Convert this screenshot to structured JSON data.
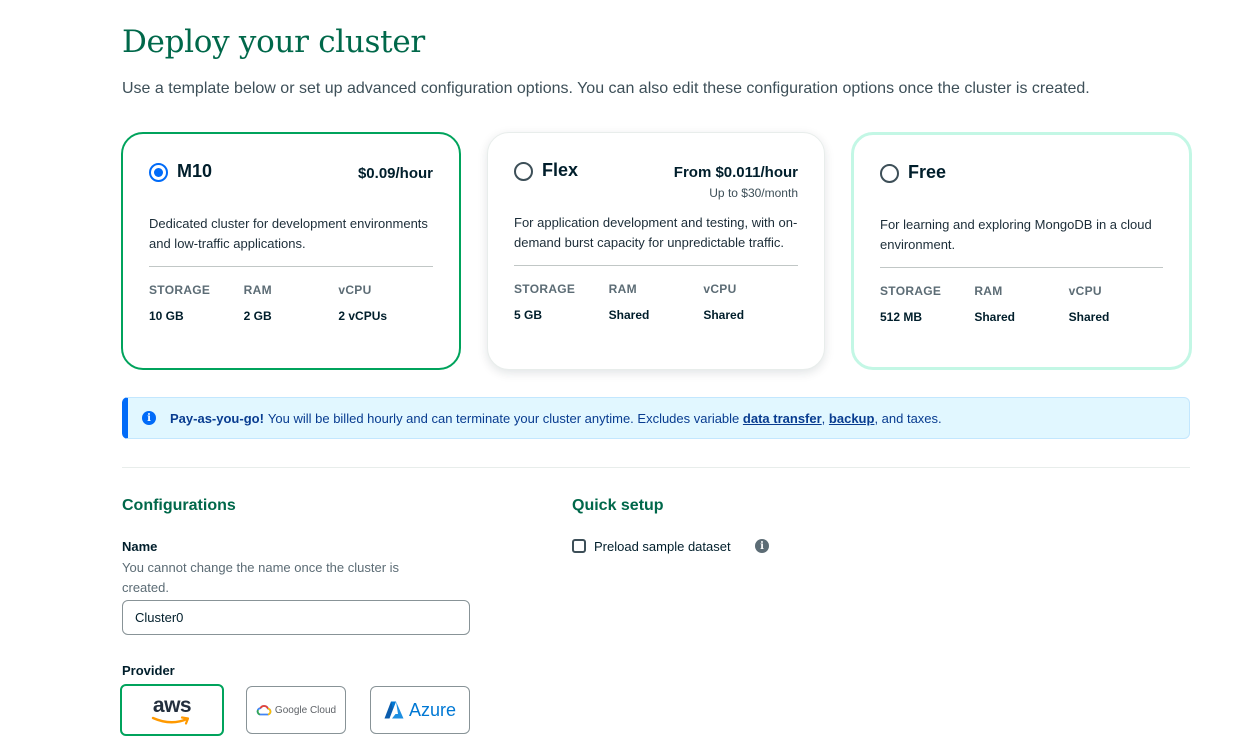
{
  "page": {
    "title": "Deploy your cluster",
    "subtitle": "Use a template below or set up advanced configuration options. You can also edit these configuration options once the cluster is created."
  },
  "tiers": [
    {
      "name": "M10",
      "price": "$0.09/hour",
      "subprice": "",
      "selected": true,
      "description": "Dedicated cluster for development environments and low-traffic applications.",
      "specs": [
        {
          "label": "STORAGE",
          "value": "10 GB"
        },
        {
          "label": "RAM",
          "value": "2 GB"
        },
        {
          "label": "vCPU",
          "value": "2 vCPUs"
        }
      ]
    },
    {
      "name": "Flex",
      "price": "From $0.011/hour",
      "subprice": "Up to $30/month",
      "selected": false,
      "description": "For application development and testing, with on-demand burst capacity for unpredictable traffic.",
      "specs": [
        {
          "label": "STORAGE",
          "value": "5 GB"
        },
        {
          "label": "RAM",
          "value": "Shared"
        },
        {
          "label": "vCPU",
          "value": "Shared"
        }
      ]
    },
    {
      "name": "Free",
      "price": "",
      "subprice": "",
      "selected": false,
      "description": "For learning and exploring MongoDB in a cloud environment.",
      "specs": [
        {
          "label": "STORAGE",
          "value": "512 MB"
        },
        {
          "label": "RAM",
          "value": "Shared"
        },
        {
          "label": "vCPU",
          "value": "Shared"
        }
      ]
    }
  ],
  "banner": {
    "strong": "Pay-as-you-go!",
    "text": "You will be billed hourly and can terminate your cluster anytime. Excludes variable",
    "link1": "data transfer",
    "sep": ",",
    "link2": "backup",
    "tail": ", and taxes.",
    "icon": "info-icon"
  },
  "configurations": {
    "title": "Configurations",
    "name_label": "Name",
    "name_help": "You cannot change the name once the cluster is created.",
    "name_value": "Cluster0",
    "provider_label": "Provider",
    "providers": [
      {
        "name": "aws",
        "selected": true
      },
      {
        "name": "Google Cloud",
        "selected": false
      },
      {
        "name": "Azure",
        "selected": false
      }
    ]
  },
  "quick_setup": {
    "title": "Quick setup",
    "preload_label": "Preload sample dataset",
    "preload_checked": false
  },
  "colors": {
    "accent_green": "#00a35c",
    "title_green": "#00684a",
    "selected_blue": "#016bf8",
    "banner_bg": "#e1f7ff"
  }
}
